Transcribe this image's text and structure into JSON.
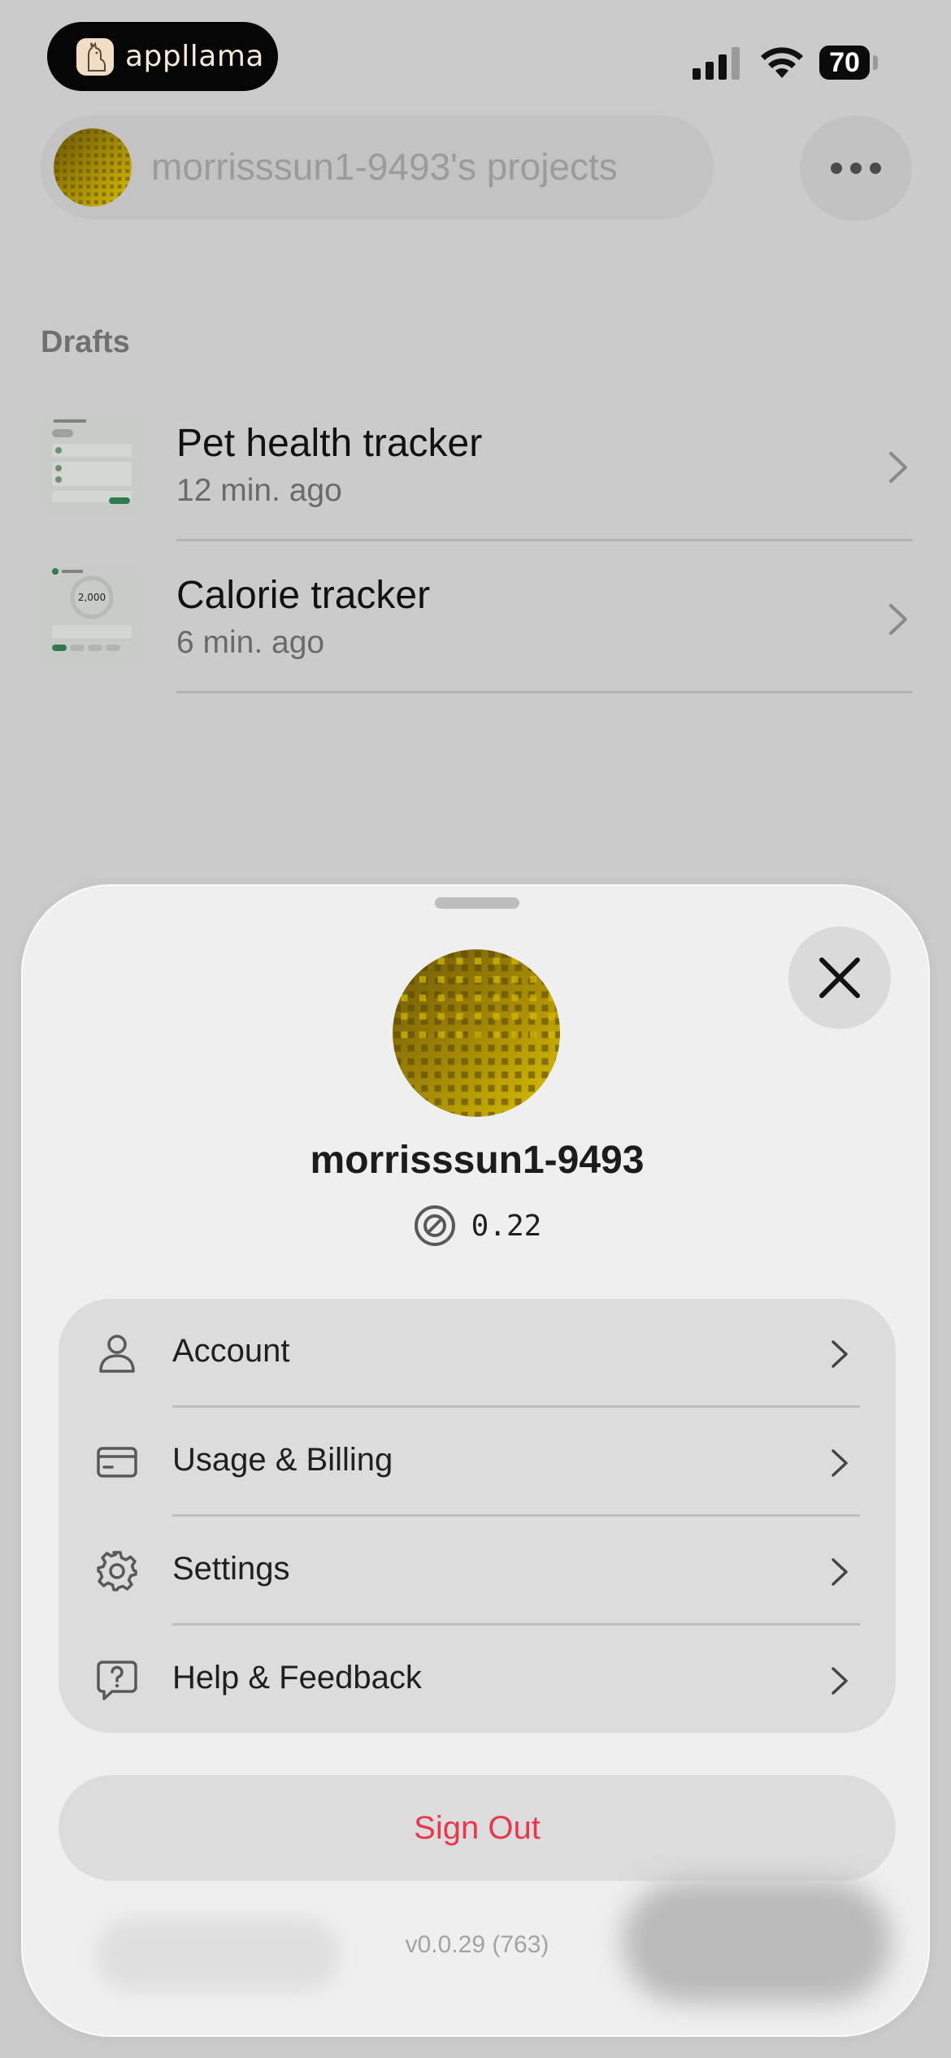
{
  "status_bar": {
    "app_name": "appllama",
    "battery": "70"
  },
  "header": {
    "project_title": "morrisssun1-9493's projects"
  },
  "drafts": {
    "section_label": "Drafts",
    "items": [
      {
        "title": "Pet health tracker",
        "time": "12 min. ago"
      },
      {
        "title": "Calorie tracker",
        "time": "6 min. ago"
      }
    ]
  },
  "sheet": {
    "username": "morrisssun1-9493",
    "credits": "0.22",
    "menu": [
      {
        "label": "Account",
        "icon": "person-icon"
      },
      {
        "label": "Usage & Billing",
        "icon": "credit-card-icon"
      },
      {
        "label": "Settings",
        "icon": "gear-icon"
      },
      {
        "label": "Help & Feedback",
        "icon": "help-bubble-icon"
      }
    ],
    "sign_out": "Sign Out",
    "version": "v0.0.29 (763)"
  },
  "colors": {
    "sign_out": "#e8384f",
    "avatar_dark": "#6b5608",
    "avatar_light": "#d8bd00"
  }
}
